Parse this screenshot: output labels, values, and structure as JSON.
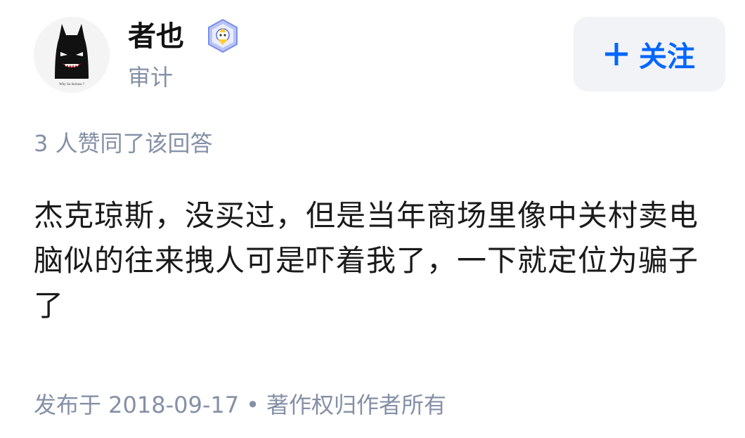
{
  "author": {
    "name": "者也",
    "headline": "审计",
    "avatar_caption": "Why So Serious ?",
    "badge_icon": "achievement-badge-icon"
  },
  "follow": {
    "label": "关注",
    "icon": "plus-icon",
    "color": "#0066ff"
  },
  "votes": {
    "text": "3 人赞同了该回答"
  },
  "answer": {
    "text": "杰克琼斯，没买过，但是当年商场里像中关村卖电脑似的往来拽人可是吓着我了，一下就定位为骗子了"
  },
  "meta": {
    "published": "发布于 2018-09-17",
    "separator": "•",
    "copyright": "著作权归作者所有"
  },
  "colors": {
    "secondary_text": "#8590a6",
    "primary_text": "#121212",
    "button_bg": "#f2f3f7"
  }
}
